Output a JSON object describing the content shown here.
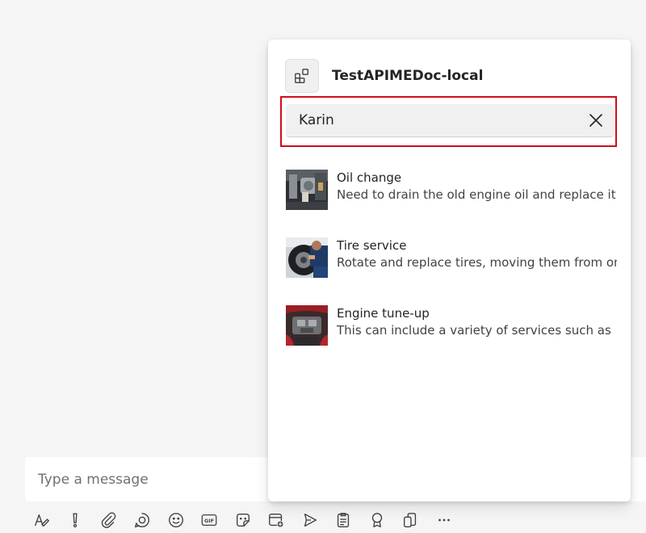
{
  "app": {
    "title": "TestAPIMEDoc-local",
    "icon": "app-grid-icon"
  },
  "search": {
    "value": "Karin",
    "clear_icon": "close-icon",
    "highlight_color": "#d00c1e"
  },
  "results": [
    {
      "title": "Oil change",
      "description": "Need to drain the old engine oil and replace it",
      "thumbnail": "oil-change-photo"
    },
    {
      "title": "Tire service",
      "description": "Rotate and replace tires, moving them from one",
      "thumbnail": "tire-service-photo"
    },
    {
      "title": "Engine tune-up",
      "description": "This can include a variety of services such as",
      "thumbnail": "engine-photo"
    }
  ],
  "compose": {
    "placeholder": "Type a message"
  },
  "toolbar": [
    "format-icon",
    "important-icon",
    "attach-icon",
    "loop-icon",
    "emoji-icon",
    "gif-icon",
    "sticker-icon",
    "schedule-meeting-icon",
    "send-later-icon",
    "forms-icon",
    "praise-icon",
    "apps-icon",
    "more-icon"
  ]
}
